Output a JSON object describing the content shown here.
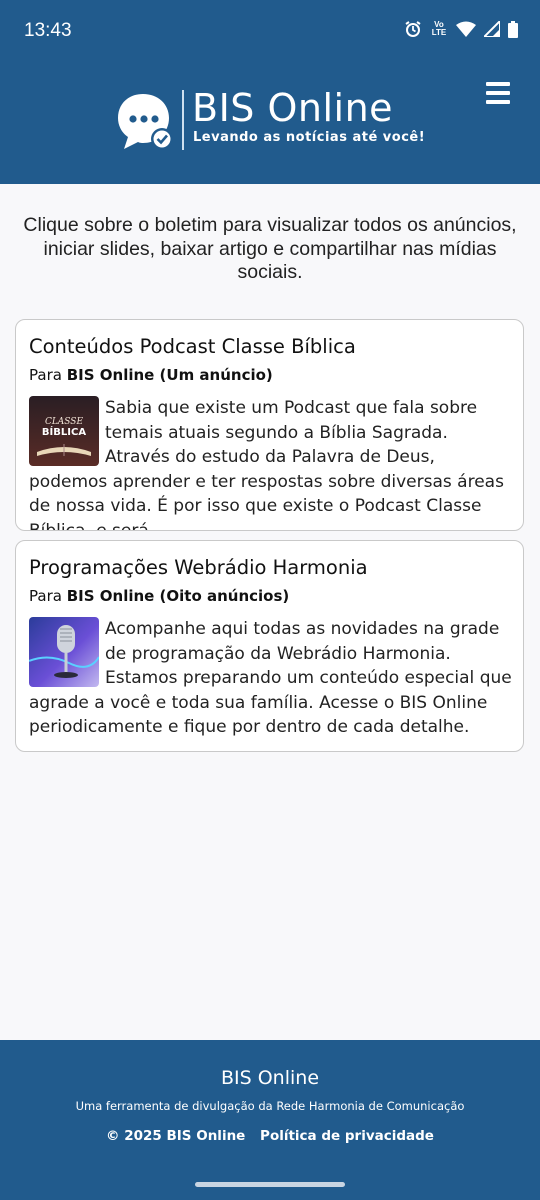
{
  "status": {
    "time": "13:43",
    "network": "Vo LTE"
  },
  "header": {
    "brand": "BIS Online",
    "tagline": "Levando as notícias até você!",
    "menu_icon": "hamburger-icon",
    "color": "#215b8d"
  },
  "intro": "Clique sobre o boletim para visualizar todos os anúncios, iniciar slides, baixar artigo e compartilhar nas mídias sociais.",
  "cards": [
    {
      "title": "Conteúdos Podcast Classe Bíblica",
      "for_prefix": "Para",
      "for_target": "BIS Online (Um anúncio)",
      "thumb_text": "CLASSE BÍBLICA",
      "text": "Sabia que existe um Podcast que fala sobre temais atuais segundo a Bíblia Sagrada. Através do estudo da Palavra de Deus, podemos aprender e ter respostas sobre diversas áreas de nossa vida. É por isso que existe o Podcast Classe Bíblica, e será"
    },
    {
      "title": "Programações Webrádio Harmonia",
      "for_prefix": "Para",
      "for_target": "BIS Online (Oito anúncios)",
      "text": "Acompanhe aqui todas as novidades na grade de programação da Webrádio Harmonia. Estamos preparando um conteúdo especial que agrade a você e toda sua família. Acesse o BIS Online periodicamente e fique por dentro de cada detalhe."
    }
  ],
  "footer": {
    "title": "BIS Online",
    "subtitle": "Uma ferramenta de divulgação da Rede Harmonia de Comunicação",
    "copyright": "© 2025 BIS Online",
    "privacy": "Política de privacidade"
  }
}
